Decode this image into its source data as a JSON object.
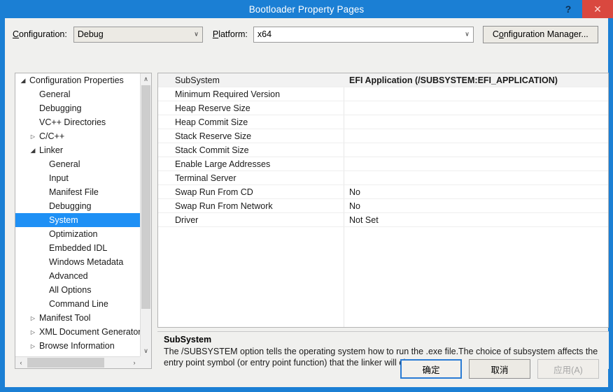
{
  "window": {
    "title": "Bootloader Property Pages",
    "help_label": "?",
    "close_label": "✕"
  },
  "config_bar": {
    "configuration_label": "Configuration:",
    "configuration_value": "Debug",
    "platform_label": "Platform:",
    "platform_value": "x64",
    "configuration_manager_label": "Configuration Manager...",
    "dropdown_arrow": "∨"
  },
  "tree": {
    "items": [
      {
        "label": "Configuration Properties",
        "depth": 0,
        "twisty": "expanded",
        "selected": false
      },
      {
        "label": "General",
        "depth": 1,
        "twisty": "none",
        "selected": false
      },
      {
        "label": "Debugging",
        "depth": 1,
        "twisty": "none",
        "selected": false
      },
      {
        "label": "VC++ Directories",
        "depth": 1,
        "twisty": "none",
        "selected": false
      },
      {
        "label": "C/C++",
        "depth": 1,
        "twisty": "collapsed",
        "selected": false
      },
      {
        "label": "Linker",
        "depth": 1,
        "twisty": "expanded",
        "selected": false
      },
      {
        "label": "General",
        "depth": 2,
        "twisty": "none",
        "selected": false
      },
      {
        "label": "Input",
        "depth": 2,
        "twisty": "none",
        "selected": false
      },
      {
        "label": "Manifest File",
        "depth": 2,
        "twisty": "none",
        "selected": false
      },
      {
        "label": "Debugging",
        "depth": 2,
        "twisty": "none",
        "selected": false
      },
      {
        "label": "System",
        "depth": 2,
        "twisty": "none",
        "selected": true
      },
      {
        "label": "Optimization",
        "depth": 2,
        "twisty": "none",
        "selected": false
      },
      {
        "label": "Embedded IDL",
        "depth": 2,
        "twisty": "none",
        "selected": false
      },
      {
        "label": "Windows Metadata",
        "depth": 2,
        "twisty": "none",
        "selected": false
      },
      {
        "label": "Advanced",
        "depth": 2,
        "twisty": "none",
        "selected": false
      },
      {
        "label": "All Options",
        "depth": 2,
        "twisty": "none",
        "selected": false
      },
      {
        "label": "Command Line",
        "depth": 2,
        "twisty": "none",
        "selected": false
      },
      {
        "label": "Manifest Tool",
        "depth": 1,
        "twisty": "collapsed",
        "selected": false
      },
      {
        "label": "XML Document Generator",
        "depth": 1,
        "twisty": "collapsed",
        "selected": false
      },
      {
        "label": "Browse Information",
        "depth": 1,
        "twisty": "collapsed",
        "selected": false
      }
    ],
    "scroll_up_arrow": "∧",
    "scroll_down_arrow": "∨",
    "scroll_left_arrow": "‹",
    "scroll_right_arrow": "›"
  },
  "grid": {
    "rows": [
      {
        "name": "SubSystem",
        "value": "EFI Application (/SUBSYSTEM:EFI_APPLICATION)",
        "active": true
      },
      {
        "name": "Minimum Required Version",
        "value": "",
        "active": false
      },
      {
        "name": "Heap Reserve Size",
        "value": "",
        "active": false
      },
      {
        "name": "Heap Commit Size",
        "value": "",
        "active": false
      },
      {
        "name": "Stack Reserve Size",
        "value": "",
        "active": false
      },
      {
        "name": "Stack Commit Size",
        "value": "",
        "active": false
      },
      {
        "name": "Enable Large Addresses",
        "value": "",
        "active": false
      },
      {
        "name": "Terminal Server",
        "value": "",
        "active": false
      },
      {
        "name": "Swap Run From CD",
        "value": "No",
        "active": false
      },
      {
        "name": "Swap Run From Network",
        "value": "No",
        "active": false
      },
      {
        "name": "Driver",
        "value": "Not Set",
        "active": false
      }
    ]
  },
  "description": {
    "title": "SubSystem",
    "text": "The /SUBSYSTEM option tells the operating system how to run the .exe file.The choice of subsystem affects the entry point symbol (or entry point function) that the linker will choose."
  },
  "footer": {
    "ok_label": "确定",
    "cancel_label": "取消",
    "apply_label": "应用(A)"
  },
  "colors": {
    "titlebar": "#1b7fd4",
    "close_button": "#d9483f",
    "selection": "#1e90f5",
    "dialog_background": "#f0f0ee"
  }
}
